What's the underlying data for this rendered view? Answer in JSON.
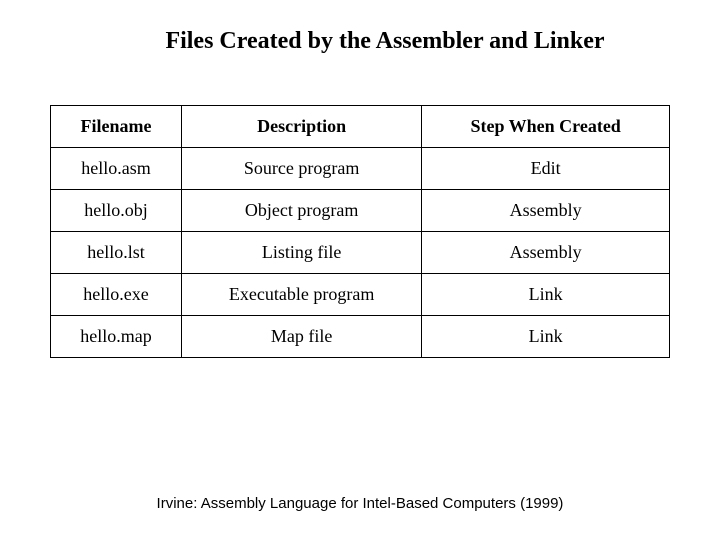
{
  "title": "Files Created by the Assembler and Linker",
  "headers": {
    "col0": "Filename",
    "col1": "Description",
    "col2": "Step When Created"
  },
  "rows": [
    {
      "filename": "hello.asm",
      "description": "Source program",
      "step": "Edit"
    },
    {
      "filename": "hello.obj",
      "description": "Object program",
      "step": "Assembly"
    },
    {
      "filename": "hello.lst",
      "description": "Listing file",
      "step": "Assembly"
    },
    {
      "filename": "hello.exe",
      "description": "Executable program",
      "step": "Link"
    },
    {
      "filename": "hello.map",
      "description": "Map file",
      "step": "Link"
    }
  ],
  "footer": "Irvine: Assembly Language for Intel-Based Computers (1999)"
}
